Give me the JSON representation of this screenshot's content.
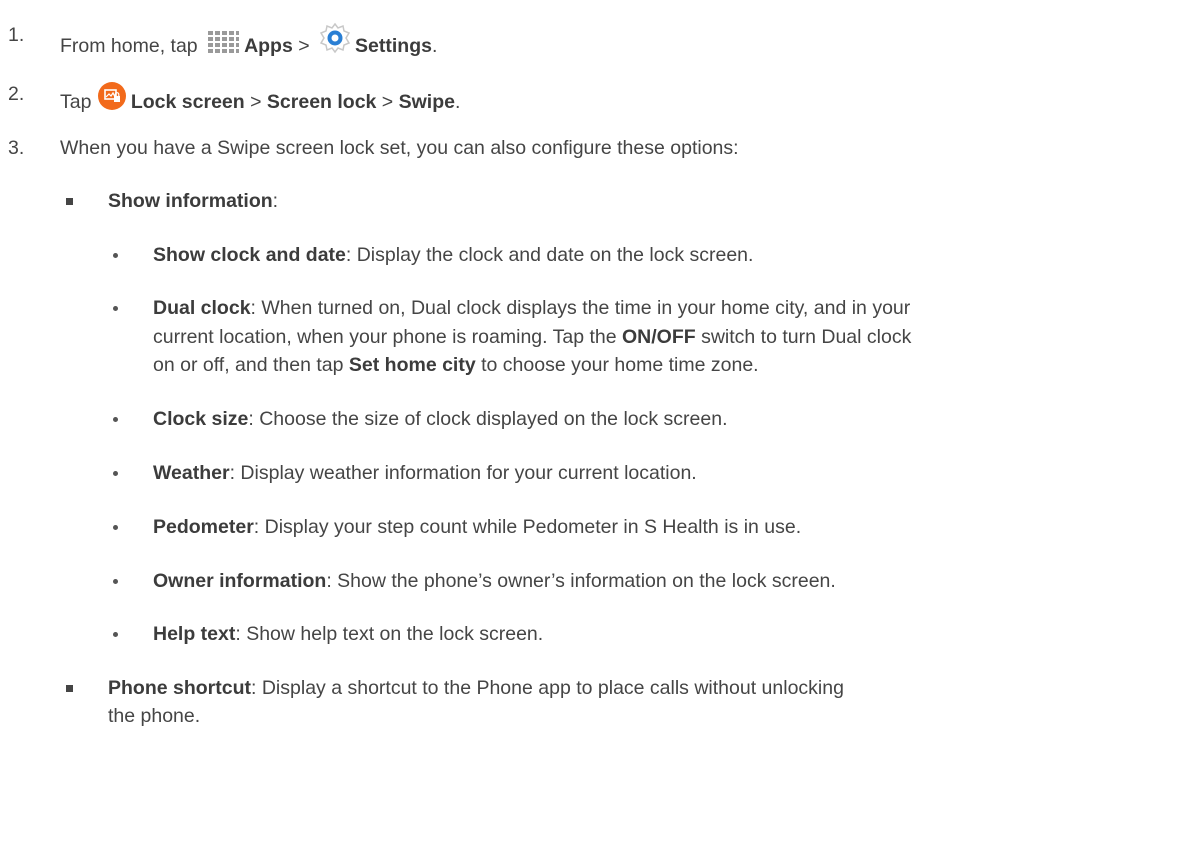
{
  "steps": [
    {
      "number": "1.",
      "parts": {
        "a": "From home, tap ",
        "b": "Apps",
        "c": " > ",
        "d": "Settings",
        "e": "."
      },
      "icons": [
        "apps-grid-icon",
        "settings-gear-icon"
      ]
    },
    {
      "number": "2.",
      "parts": {
        "a": "Tap ",
        "b": "Lock screen",
        "c": " > ",
        "d": "Screen lock",
        "e": " > ",
        "f": "Swipe",
        "g": "."
      },
      "icons": [
        "lock-screen-icon"
      ]
    },
    {
      "number": "3.",
      "text": "When you have a Swipe screen lock set, you can also configure these options:"
    }
  ],
  "options": {
    "show_information": {
      "label": "Show information",
      "suffix": ":"
    },
    "sub_items": [
      {
        "label": "Show clock and date",
        "desc": ": Display the clock and date on the lock screen."
      },
      {
        "label": "Dual clock",
        "desc_line1": ": When turned on, Dual clock displays the time in your home city, and in your",
        "desc_line2a": "current location, when your phone is roaming. Tap the ",
        "desc_line2b": "ON/OFF",
        "desc_line2c": " switch to turn Dual clock",
        "desc_line3a": "on or off, and then tap ",
        "desc_line3b": "Set home city",
        "desc_line3c": " to choose your home time zone."
      },
      {
        "label": "Clock size",
        "desc": ": Choose the size of clock displayed on the lock screen."
      },
      {
        "label": "Weather",
        "desc": ": Display weather information for your current location."
      },
      {
        "label": "Pedometer",
        "desc": ": Display your step count while Pedometer in S Health is in use."
      },
      {
        "label": "Owner information",
        "desc": ": Show the phone’s owner’s information on the lock screen."
      },
      {
        "label": "Help text",
        "desc": ": Show help text on the lock screen."
      }
    ],
    "phone_shortcut": {
      "label": "Phone shortcut",
      "desc_line1": ": Display a shortcut to the Phone app to place calls without unlocking",
      "desc_line2": "the phone."
    }
  },
  "colors": {
    "text": "#454545",
    "lock_icon": "#f26a1b",
    "settings_icon": "#2a7fd4",
    "apps_icon": "#9a9a9a"
  }
}
